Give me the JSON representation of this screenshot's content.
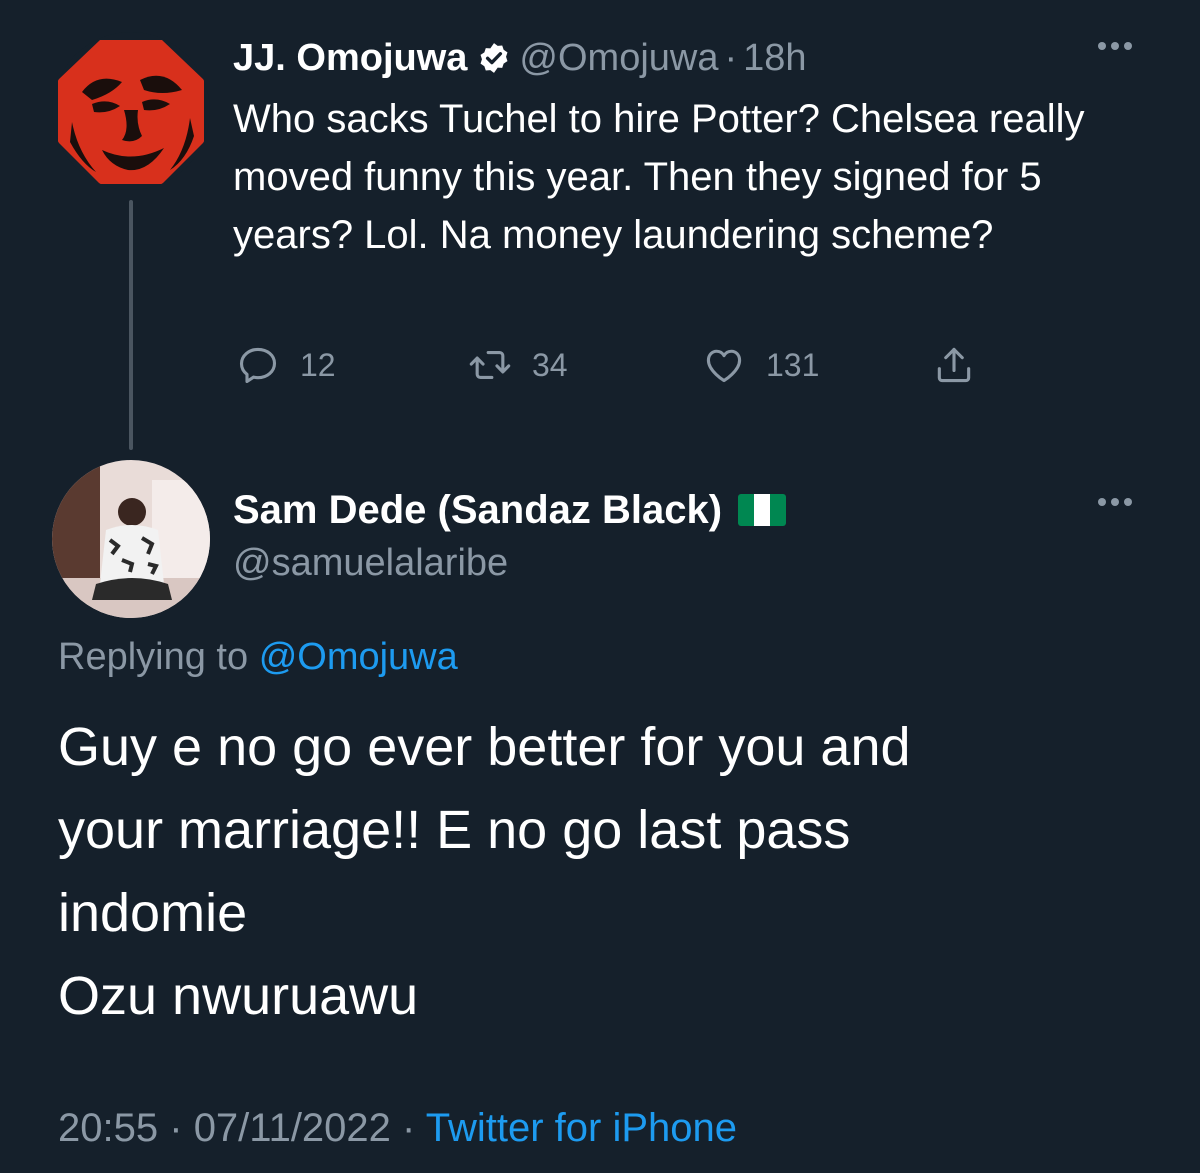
{
  "parent_tweet": {
    "author_name": "JJ. Omojuwa",
    "verified": true,
    "handle": "@Omojuwa",
    "separator": "·",
    "time_ago": "18h",
    "text": "Who sacks Tuchel to hire Potter? Chelsea really moved funny this year. Then they signed for 5 years? Lol. Na money laundering scheme?",
    "actions": {
      "replies": "12",
      "retweets": "34",
      "likes": "131"
    },
    "icons": [
      "more-icon",
      "reply-icon",
      "retweet-icon",
      "like-icon",
      "share-icon",
      "verified-badge-icon"
    ]
  },
  "reply_tweet": {
    "author_name": "Sam Dede (Sandaz Black)",
    "flag": "nigeria-flag",
    "handle": "@samuelalaribe",
    "replying_prefix": "Replying to",
    "replying_to": "@Omojuwa",
    "text_lines": [
      "Guy e no go ever better for you and",
      "your marriage!! E no go last pass",
      "indomie",
      "Ozu nwuruawu"
    ],
    "timestamp_time": "20:55",
    "separator": "·",
    "timestamp_date": "07/11/2022",
    "source": "Twitter for iPhone"
  },
  "colors": {
    "background": "#15202b",
    "primary_text": "#ffffff",
    "secondary_text": "#8b98a5",
    "link": "#1d9bf0",
    "thread_line": "#4a5560"
  }
}
